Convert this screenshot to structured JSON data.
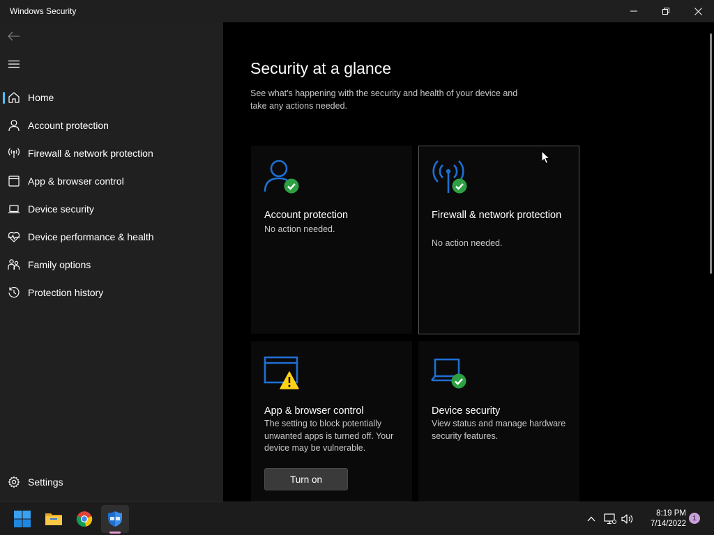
{
  "window": {
    "title": "Windows Security",
    "controls": {
      "minimize": "minimize-icon",
      "restore": "restore-icon",
      "close": "close-icon"
    }
  },
  "sidebar": {
    "back_icon": "back-arrow-icon",
    "menu_icon": "hamburger-menu-icon",
    "items": [
      {
        "label": "Home",
        "icon": "home-icon",
        "active": true
      },
      {
        "label": "Account protection",
        "icon": "person-icon"
      },
      {
        "label": "Firewall & network protection",
        "icon": "antenna-icon"
      },
      {
        "label": "App & browser control",
        "icon": "browser-window-icon"
      },
      {
        "label": "Device security",
        "icon": "laptop-icon"
      },
      {
        "label": "Device performance & health",
        "icon": "heart-pulse-icon"
      },
      {
        "label": "Family options",
        "icon": "family-icon"
      },
      {
        "label": "Protection history",
        "icon": "history-icon"
      }
    ],
    "settings": {
      "label": "Settings",
      "icon": "gear-icon"
    }
  },
  "main": {
    "title": "Security at a glance",
    "description": "See what's happening with the security and health of your device and take any actions needed.",
    "cards": [
      {
        "title": "Account protection",
        "status": "No action needed.",
        "icon": "person-icon",
        "badge": "check-icon"
      },
      {
        "title": "Firewall & network protection",
        "status": "No action needed.",
        "icon": "antenna-icon",
        "badge": "check-icon"
      },
      {
        "title": "App & browser control",
        "status": "The setting to block potentially unwanted apps is turned off. Your device may be vulnerable.",
        "icon": "browser-window-icon",
        "badge": "warning-icon",
        "button": "Turn on"
      },
      {
        "title": "Device security",
        "status": "View status and manage hardware security features.",
        "icon": "laptop-icon",
        "badge": "check-icon"
      }
    ]
  },
  "taskbar": {
    "apps": [
      "windows-start-icon",
      "file-explorer-icon",
      "chrome-icon",
      "windows-security-icon"
    ],
    "tray": [
      "chevron-up-icon",
      "network-icon",
      "volume-icon"
    ],
    "time": "8:19 PM",
    "date": "7/14/2022",
    "notifications": "1"
  },
  "colors": {
    "accent": "#4cc2ff",
    "icon_blue": "#1f6fd1",
    "success": "#2ea043",
    "warning": "#fcd116",
    "sidebar_bg": "#202020"
  }
}
